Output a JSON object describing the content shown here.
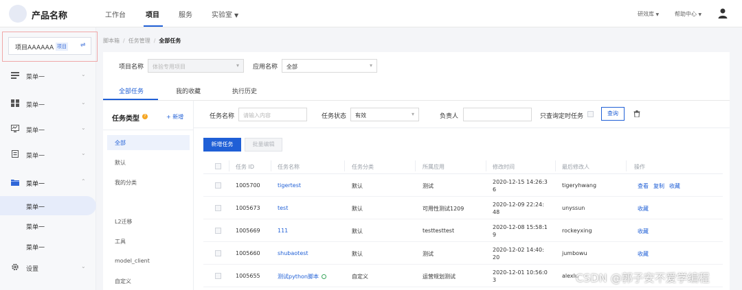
{
  "header": {
    "product_name": "产品名称",
    "nav": [
      {
        "label": "工作台"
      },
      {
        "label": "项目"
      },
      {
        "label": "服务"
      },
      {
        "label": "实验室"
      }
    ],
    "right": [
      {
        "label": "研效库"
      },
      {
        "label": "帮助中心"
      }
    ]
  },
  "sidebar": {
    "project": {
      "name": "项目AAAAAA",
      "tag": "项目",
      "swap": "⇌"
    },
    "menus": [
      {
        "label": "菜单一",
        "icon": "menu-icon"
      },
      {
        "label": "菜单一",
        "icon": "menu-icon"
      },
      {
        "label": "菜单一",
        "icon": "menu-icon"
      },
      {
        "label": "菜单一",
        "icon": "menu-icon"
      },
      {
        "label": "菜单一",
        "icon": "menu-icon",
        "expanded": true
      }
    ],
    "sub_items": [
      {
        "label": "菜单一"
      },
      {
        "label": "菜单一"
      },
      {
        "label": "菜单一"
      }
    ],
    "settings": {
      "label": "设置",
      "icon": "gear-icon"
    }
  },
  "breadcrumb": [
    "脚本箱",
    "任务管理",
    "全部任务"
  ],
  "filters": {
    "project_label": "项目名称",
    "project_placeholder": "体验专用项目",
    "app_label": "应用名称",
    "app_value": "全部"
  },
  "tabs": [
    {
      "label": "全部任务"
    },
    {
      "label": "我的收藏"
    },
    {
      "label": "执行历史"
    }
  ],
  "categories": {
    "title": "任务类型",
    "new_label": "+ 新增",
    "items": [
      {
        "label": "全部"
      },
      {
        "label": "默认"
      },
      {
        "label": "我的分类"
      },
      {
        "label": "L2迁移"
      },
      {
        "label": "工具"
      },
      {
        "label": "model_client"
      },
      {
        "label": "自定义"
      }
    ]
  },
  "search": {
    "name_label": "任务名称",
    "name_placeholder": "请输入内容",
    "status_label": "任务状态",
    "status_value": "有效",
    "owner_label": "负责人",
    "scheduled_label": "只查询定时任务",
    "query_label": "查询"
  },
  "actions": {
    "new_task": "新增任务",
    "batch_edit": "批量编辑"
  },
  "table": {
    "columns": [
      "任务 ID",
      "任务名称",
      "任务分类",
      "所属应用",
      "修改时间",
      "最后修改人",
      "操作"
    ],
    "rows": [
      {
        "id": "1005700",
        "name": "tigertest",
        "category": "默认",
        "app": "测试",
        "time_1": "2020-12-15 14:26:3",
        "time_2": "6",
        "modifier": "tigeryhwang",
        "ops": [
          "查看",
          "复制",
          "收藏"
        ]
      },
      {
        "id": "1005673",
        "name": "test",
        "category": "默认",
        "app": "可用性测试1209",
        "time_1": "2020-12-09 22:24:",
        "time_2": "48",
        "modifier": "unyssun",
        "ops": [
          "收藏"
        ]
      },
      {
        "id": "1005669",
        "name": "111",
        "category": "默认",
        "app": "testtesttest",
        "time_1": "2020-12-08 15:58:1",
        "time_2": "9",
        "modifier": "rockeyxing",
        "ops": [
          "收藏"
        ]
      },
      {
        "id": "1005660",
        "name": "shubaotest",
        "category": "默认",
        "app": "测试",
        "time_1": "2020-12-02 14:40:",
        "time_2": "20",
        "modifier": "jumbowu",
        "ops": [
          "收藏"
        ]
      },
      {
        "id": "1005655",
        "name": "测试python脚本",
        "category": "自定义",
        "app": "运营规划测试",
        "time_1": "2020-12-01 10:56:0",
        "time_2": "3",
        "modifier": "alexlu",
        "ops": []
      }
    ]
  },
  "watermark": "CSDN @郭子安不爱学编程"
}
